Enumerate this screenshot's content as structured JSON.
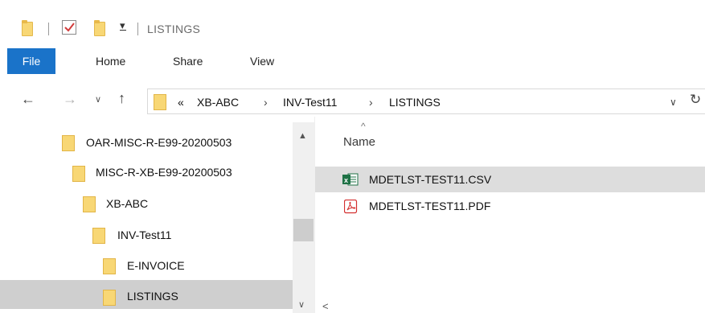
{
  "title": "LISTINGS",
  "ribbon": {
    "file_tab": "File",
    "tabs": [
      "Home",
      "Share",
      "View"
    ]
  },
  "address": {
    "overflow_glyph": "«",
    "crumbs": [
      "XB-ABC",
      "INV-Test11",
      "LISTINGS"
    ],
    "separator": "›"
  },
  "tree": [
    {
      "label": "OAR-MISC-R-E99-20200503"
    },
    {
      "label": "MISC-R-XB-E99-20200503"
    },
    {
      "label": "XB-ABC"
    },
    {
      "label": "INV-Test11"
    },
    {
      "label": "E-INVOICE"
    },
    {
      "label": "LISTINGS",
      "selected": true
    }
  ],
  "list": {
    "column_name": "Name",
    "files": [
      {
        "name": "MDETLST-TEST11.CSV",
        "icon": "excel-csv-icon",
        "selected": true
      },
      {
        "name": "MDETLST-TEST11.PDF",
        "icon": "pdf-icon",
        "selected": false
      }
    ]
  },
  "colors": {
    "accent": "#1a73c9",
    "folder": "#f8d775",
    "selection": "#dddddd"
  }
}
